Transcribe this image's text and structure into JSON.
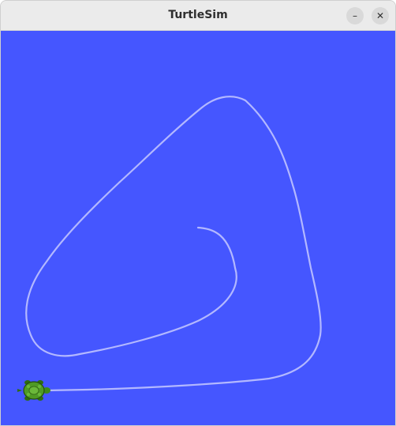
{
  "window": {
    "title": "TurtleSim",
    "minimize_glyph": "–",
    "close_glyph": "✕"
  },
  "canvas": {
    "background_color": "#4556ff",
    "pen_color": "#b3b8ff",
    "turtle_icon": "turtle-icon"
  }
}
